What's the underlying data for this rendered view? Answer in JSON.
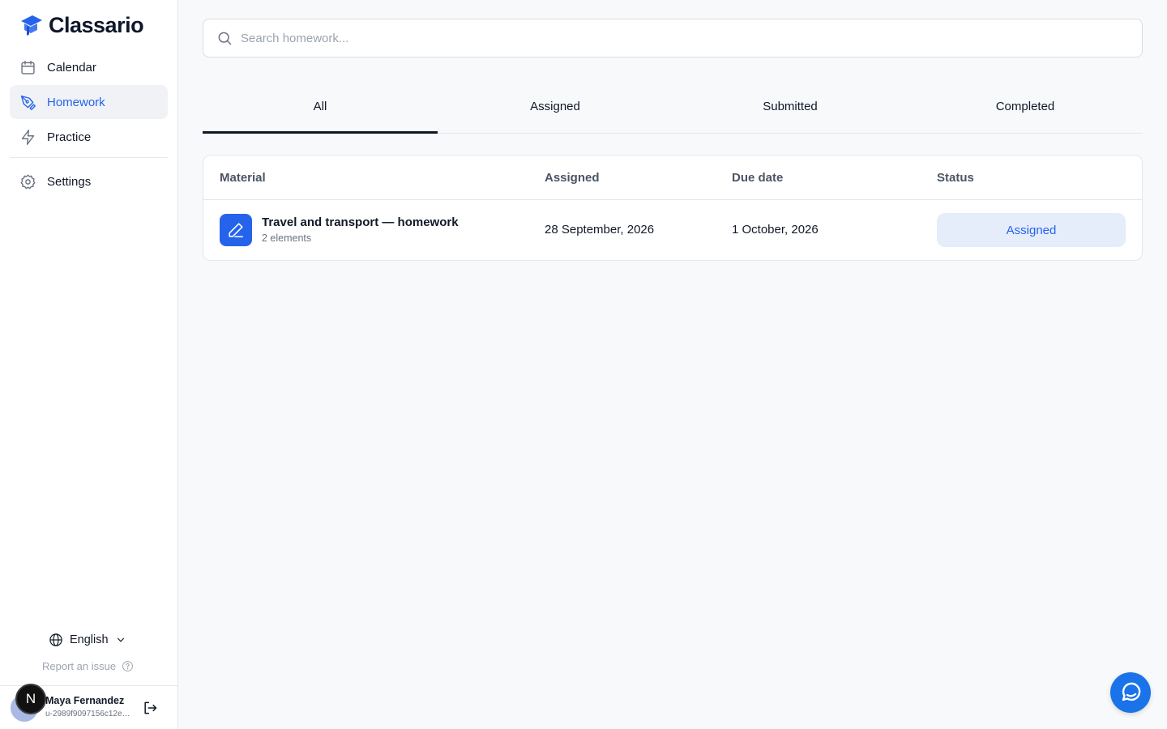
{
  "app": {
    "name": "Classario",
    "accent_color": "#2563eb"
  },
  "sidebar": {
    "items": [
      {
        "label": "Calendar",
        "icon": "calendar-icon"
      },
      {
        "label": "Homework",
        "icon": "pen-tool-icon",
        "active": true
      },
      {
        "label": "Practice",
        "icon": "lightning-icon"
      },
      {
        "label": "Settings",
        "icon": "gear-icon"
      }
    ],
    "language": "English",
    "report_issue": "Report an issue"
  },
  "user": {
    "initial": "N",
    "name": "Maya Fernandez",
    "id": "u-2989f9097156c12e…"
  },
  "search": {
    "placeholder": "Search homework..."
  },
  "tabs": [
    {
      "label": "All",
      "active": true
    },
    {
      "label": "Assigned"
    },
    {
      "label": "Submitted"
    },
    {
      "label": "Completed"
    }
  ],
  "table": {
    "headers": {
      "material": "Material",
      "assigned": "Assigned",
      "due_date": "Due date",
      "status": "Status"
    },
    "rows": [
      {
        "title": "Travel and transport — homework",
        "subtitle": "2 elements",
        "assigned": "28 September, 2026",
        "due_date": "1 October, 2026",
        "status": "Assigned"
      }
    ]
  }
}
